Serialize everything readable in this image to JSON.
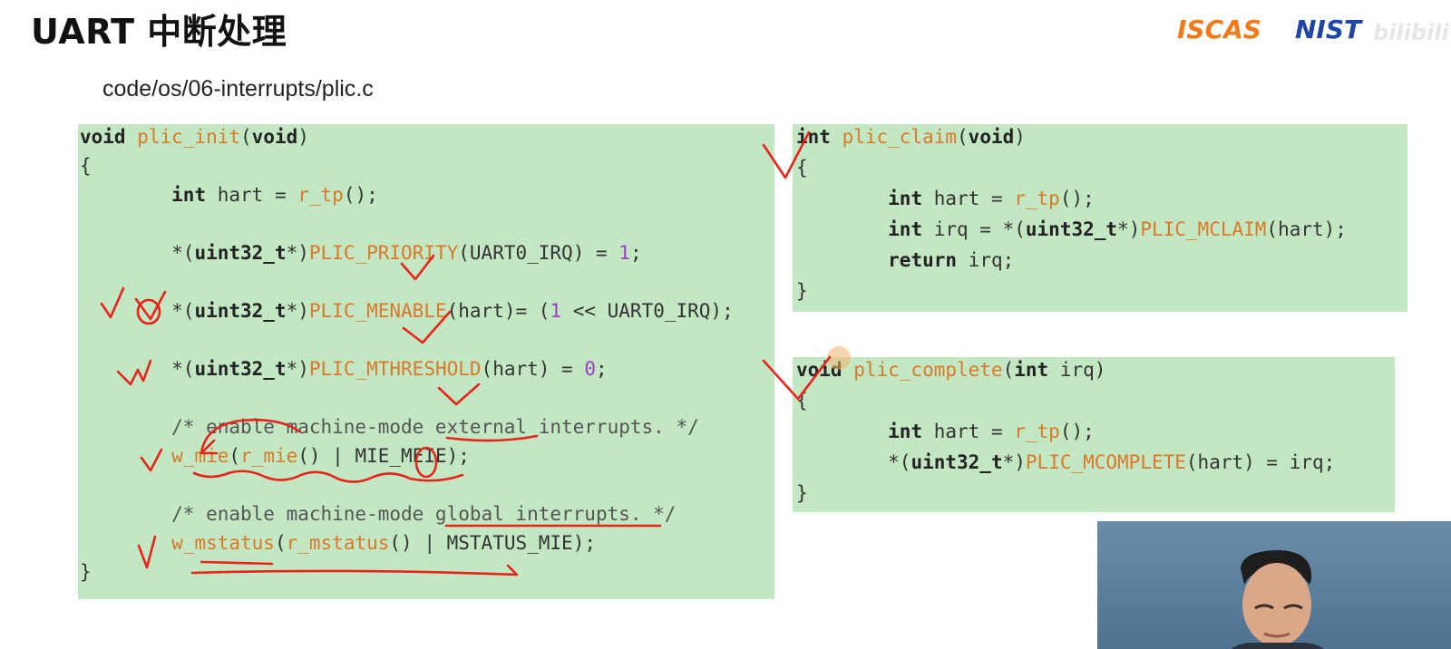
{
  "slide": {
    "title": "UART 中断处理",
    "path": "code/os/06-interrupts/plic.c"
  },
  "logos": {
    "left": "ISCAS",
    "right": "NIST",
    "watermark": "bilibili"
  },
  "code_init": [
    {
      "parts": [
        [
          "kw",
          "void "
        ],
        [
          "fn",
          "plic_init"
        ],
        [
          "",
          "("
        ],
        [
          "kw",
          "void"
        ],
        [
          "",
          ")"
        ]
      ]
    },
    {
      "parts": [
        [
          "",
          "{"
        ]
      ]
    },
    {
      "parts": [
        [
          "",
          "        "
        ],
        [
          "kw",
          "int "
        ],
        [
          "",
          "hart = "
        ],
        [
          "fn",
          "r_tp"
        ],
        [
          "",
          "();"
        ]
      ]
    },
    {
      "parts": [
        [
          "",
          "        *("
        ],
        [
          "kw",
          "uint32_t"
        ],
        [
          "",
          "*)"
        ],
        [
          "fn",
          "PLIC_PRIORITY"
        ],
        [
          "",
          "(UART0_IRQ) = "
        ],
        [
          "num",
          "1"
        ],
        [
          "",
          ";"
        ]
      ]
    },
    {
      "parts": [
        [
          "",
          "        *("
        ],
        [
          "kw",
          "uint32_t"
        ],
        [
          "",
          "*)"
        ],
        [
          "fn",
          "PLIC_MENABLE"
        ],
        [
          "",
          "(hart)= ("
        ],
        [
          "num",
          "1"
        ],
        [
          "",
          " << UART0_IRQ);"
        ]
      ]
    },
    {
      "parts": [
        [
          "",
          "        *("
        ],
        [
          "kw",
          "uint32_t"
        ],
        [
          "",
          "*)"
        ],
        [
          "fn",
          "PLIC_MTHRESHOLD"
        ],
        [
          "",
          "(hart) = "
        ],
        [
          "num",
          "0"
        ],
        [
          "",
          ";"
        ]
      ]
    },
    {
      "parts": [
        [
          "cm",
          "        /* enable machine-mode external interrupts. */"
        ]
      ]
    },
    {
      "parts": [
        [
          "",
          "        "
        ],
        [
          "fn",
          "w_mie"
        ],
        [
          "",
          "("
        ],
        [
          "fn",
          "r_mie"
        ],
        [
          "",
          "() | MIE_MEIE);"
        ]
      ]
    },
    {
      "parts": [
        [
          "cm",
          "        /* enable machine-mode global interrupts. */"
        ]
      ]
    },
    {
      "parts": [
        [
          "",
          "        "
        ],
        [
          "fn",
          "w_mstatus"
        ],
        [
          "",
          "("
        ],
        [
          "fn",
          "r_mstatus"
        ],
        [
          "",
          "() | MSTATUS_MIE);"
        ]
      ]
    },
    {
      "parts": [
        [
          "",
          "}"
        ]
      ]
    }
  ],
  "code_claim": [
    {
      "parts": [
        [
          "kw",
          "int "
        ],
        [
          "fn",
          "plic_claim"
        ],
        [
          "",
          "("
        ],
        [
          "kw",
          "void"
        ],
        [
          "",
          ")"
        ]
      ]
    },
    {
      "parts": [
        [
          "",
          "{"
        ]
      ]
    },
    {
      "parts": [
        [
          "",
          "        "
        ],
        [
          "kw",
          "int "
        ],
        [
          "",
          "hart = "
        ],
        [
          "fn",
          "r_tp"
        ],
        [
          "",
          "();"
        ]
      ]
    },
    {
      "parts": [
        [
          "",
          "        "
        ],
        [
          "kw",
          "int "
        ],
        [
          "",
          "irq = *("
        ],
        [
          "kw",
          "uint32_t"
        ],
        [
          "",
          "*)"
        ],
        [
          "fn",
          "PLIC_MCLAIM"
        ],
        [
          "",
          "(hart);"
        ]
      ]
    },
    {
      "parts": [
        [
          "",
          "        "
        ],
        [
          "kw",
          "return "
        ],
        [
          "",
          "irq;"
        ]
      ]
    },
    {
      "parts": [
        [
          "",
          "}"
        ]
      ]
    }
  ],
  "code_complete": [
    {
      "parts": [
        [
          "kw",
          "void "
        ],
        [
          "fn",
          "plic_complete"
        ],
        [
          "",
          "("
        ],
        [
          "kw",
          "int "
        ],
        [
          "",
          "irq)"
        ]
      ]
    },
    {
      "parts": [
        [
          "",
          "{"
        ]
      ]
    },
    {
      "parts": [
        [
          "",
          "        "
        ],
        [
          "kw",
          "int "
        ],
        [
          "",
          "hart = "
        ],
        [
          "fn",
          "r_tp"
        ],
        [
          "",
          "();"
        ]
      ]
    },
    {
      "parts": [
        [
          "",
          "        *("
        ],
        [
          "kw",
          "uint32_t"
        ],
        [
          "",
          "*)"
        ],
        [
          "fn",
          "PLIC_MCOMPLETE"
        ],
        [
          "",
          "(hart) = irq;"
        ]
      ]
    },
    {
      "parts": [
        [
          "",
          "}"
        ]
      ]
    }
  ],
  "colors": {
    "panel_bg": "#c3e7c3",
    "function": "#d9792a",
    "number": "#9b3fc7",
    "ink": "#e8231a"
  }
}
